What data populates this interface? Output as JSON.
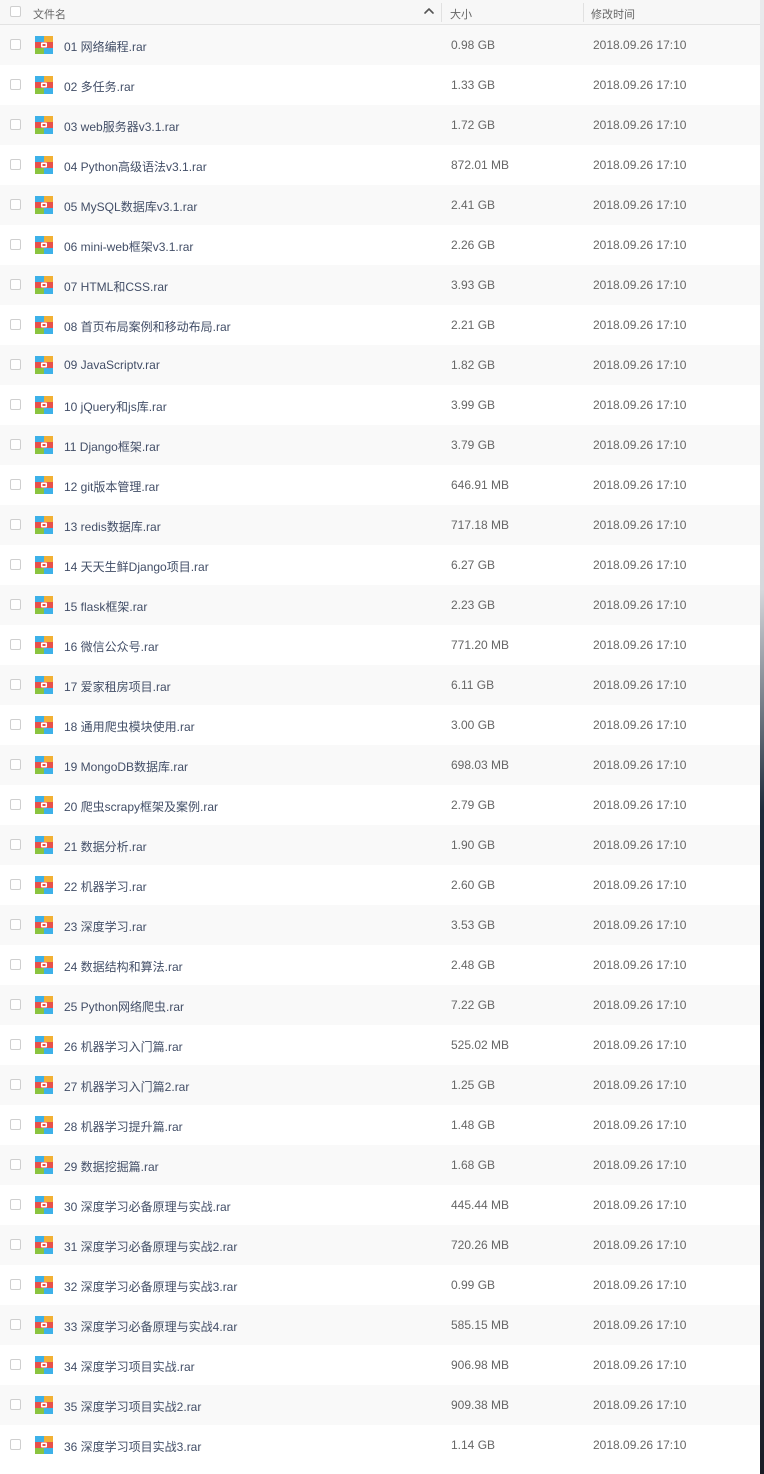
{
  "header": {
    "name_label": "文件名",
    "size_label": "大小",
    "time_label": "修改时间",
    "sort_icon": "chevron-up-icon"
  },
  "file_icon": "rar-archive-icon",
  "colors": {
    "header_bg": "#f7f7f7",
    "row_alt_bg": "#f9f9f9",
    "filename_text": "#424e67",
    "meta_text": "#666666"
  },
  "files": [
    {
      "name": "01 网络编程.rar",
      "size": "0.98 GB",
      "time": "2018.09.26 17:10"
    },
    {
      "name": "02 多任务.rar",
      "size": "1.33 GB",
      "time": "2018.09.26 17:10"
    },
    {
      "name": "03 web服务器v3.1.rar",
      "size": "1.72 GB",
      "time": "2018.09.26 17:10"
    },
    {
      "name": "04 Python高级语法v3.1.rar",
      "size": "872.01 MB",
      "time": "2018.09.26 17:10"
    },
    {
      "name": "05 MySQL数据库v3.1.rar",
      "size": "2.41 GB",
      "time": "2018.09.26 17:10"
    },
    {
      "name": "06 mini-web框架v3.1.rar",
      "size": "2.26 GB",
      "time": "2018.09.26 17:10"
    },
    {
      "name": "07 HTML和CSS.rar",
      "size": "3.93 GB",
      "time": "2018.09.26 17:10"
    },
    {
      "name": "08 首页布局案例和移动布局.rar",
      "size": "2.21 GB",
      "time": "2018.09.26 17:10"
    },
    {
      "name": "09 JavaScriptv.rar",
      "size": "1.82 GB",
      "time": "2018.09.26 17:10"
    },
    {
      "name": "10 jQuery和js库.rar",
      "size": "3.99 GB",
      "time": "2018.09.26 17:10"
    },
    {
      "name": "11 Django框架.rar",
      "size": "3.79 GB",
      "time": "2018.09.26 17:10"
    },
    {
      "name": "12 git版本管理.rar",
      "size": "646.91 MB",
      "time": "2018.09.26 17:10"
    },
    {
      "name": "13 redis数据库.rar",
      "size": "717.18 MB",
      "time": "2018.09.26 17:10"
    },
    {
      "name": "14 天天生鲜Django项目.rar",
      "size": "6.27 GB",
      "time": "2018.09.26 17:10"
    },
    {
      "name": "15 flask框架.rar",
      "size": "2.23 GB",
      "time": "2018.09.26 17:10"
    },
    {
      "name": "16 微信公众号.rar",
      "size": "771.20 MB",
      "time": "2018.09.26 17:10"
    },
    {
      "name": "17 爱家租房项目.rar",
      "size": "6.11 GB",
      "time": "2018.09.26 17:10"
    },
    {
      "name": "18 通用爬虫模块使用.rar",
      "size": "3.00 GB",
      "time": "2018.09.26 17:10"
    },
    {
      "name": "19 MongoDB数据库.rar",
      "size": "698.03 MB",
      "time": "2018.09.26 17:10"
    },
    {
      "name": "20 爬虫scrapy框架及案例.rar",
      "size": "2.79 GB",
      "time": "2018.09.26 17:10"
    },
    {
      "name": "21 数据分析.rar",
      "size": "1.90 GB",
      "time": "2018.09.26 17:10"
    },
    {
      "name": "22 机器学习.rar",
      "size": "2.60 GB",
      "time": "2018.09.26 17:10"
    },
    {
      "name": "23 深度学习.rar",
      "size": "3.53 GB",
      "time": "2018.09.26 17:10"
    },
    {
      "name": "24 数据结构和算法.rar",
      "size": "2.48 GB",
      "time": "2018.09.26 17:10"
    },
    {
      "name": "25 Python网络爬虫.rar",
      "size": "7.22 GB",
      "time": "2018.09.26 17:10"
    },
    {
      "name": "26 机器学习入门篇.rar",
      "size": "525.02 MB",
      "time": "2018.09.26 17:10"
    },
    {
      "name": "27 机器学习入门篇2.rar",
      "size": "1.25 GB",
      "time": "2018.09.26 17:10"
    },
    {
      "name": "28 机器学习提升篇.rar",
      "size": "1.48 GB",
      "time": "2018.09.26 17:10"
    },
    {
      "name": "29 数据挖掘篇.rar",
      "size": "1.68 GB",
      "time": "2018.09.26 17:10"
    },
    {
      "name": "30 深度学习必备原理与实战.rar",
      "size": "445.44 MB",
      "time": "2018.09.26 17:10"
    },
    {
      "name": "31 深度学习必备原理与实战2.rar",
      "size": "720.26 MB",
      "time": "2018.09.26 17:10"
    },
    {
      "name": "32 深度学习必备原理与实战3.rar",
      "size": "0.99 GB",
      "time": "2018.09.26 17:10"
    },
    {
      "name": "33 深度学习必备原理与实战4.rar",
      "size": "585.15 MB",
      "time": "2018.09.26 17:10"
    },
    {
      "name": "34 深度学习项目实战.rar",
      "size": "906.98 MB",
      "time": "2018.09.26 17:10"
    },
    {
      "name": "35 深度学习项目实战2.rar",
      "size": "909.38 MB",
      "time": "2018.09.26 17:10"
    },
    {
      "name": "36 深度学习项目实战3.rar",
      "size": "1.14 GB",
      "time": "2018.09.26 17:10"
    }
  ]
}
